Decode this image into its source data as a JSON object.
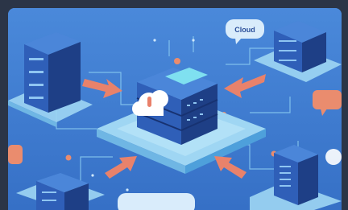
{
  "cloud_label": "Cloud",
  "colors": {
    "background": "#3f7ed2",
    "frame": "#2b3547",
    "platform": "#9fd6f3",
    "server_front": "#2f5fb8",
    "server_side": "#1e3f86",
    "server_top": "#4b86d9",
    "arrow": "#e8826b",
    "accent": "#ea8c6e",
    "bubble": "#d9ecfb"
  },
  "icons": {
    "central_server": "server-rack-icon",
    "cloud_badge": "cloud-icon"
  }
}
